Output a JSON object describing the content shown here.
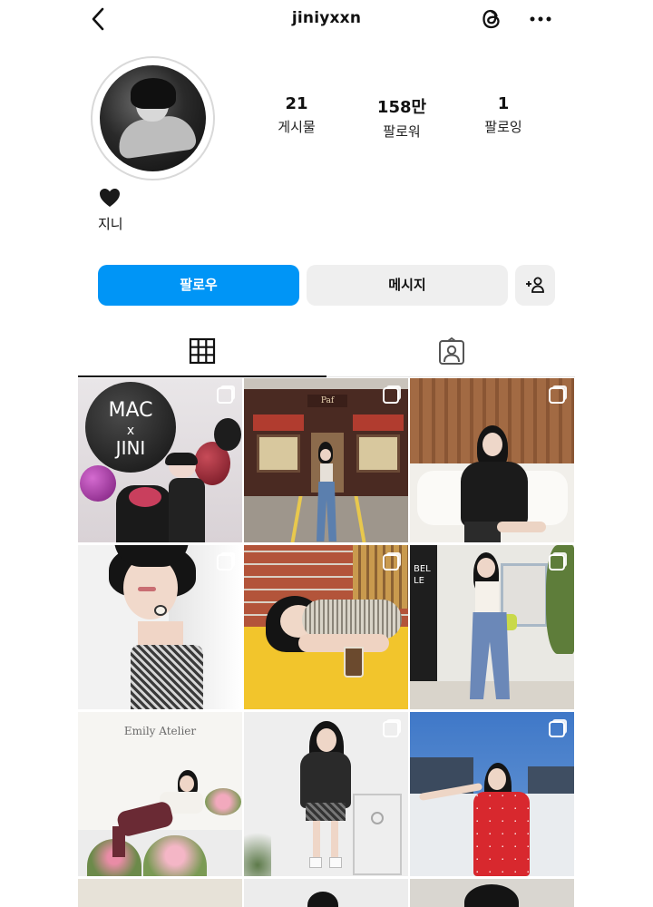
{
  "header": {
    "username": "jiniyxxn",
    "back_icon": "chevron-left-icon",
    "threads_icon": "threads-icon",
    "more_icon": "more-horizontal-icon"
  },
  "profile": {
    "avatar_icon": "profile-photo",
    "stats": [
      {
        "value": "21",
        "label": "게시물"
      },
      {
        "value": "158만",
        "label": "팔로워"
      },
      {
        "value": "1",
        "label": "팔로잉"
      }
    ],
    "bio_emoji": "black-heart-icon",
    "name": "지니"
  },
  "actions": {
    "follow_label": "팔로우",
    "message_label": "메시지",
    "add_user_icon": "add-user-icon",
    "follow_color": "#0095f6"
  },
  "tabs": [
    {
      "icon": "grid-icon",
      "active": true
    },
    {
      "icon": "tagged-icon",
      "active": false
    }
  ],
  "posts": [
    {
      "text_lines": [
        "MAC",
        "x",
        "JINI"
      ],
      "multi": true
    },
    {
      "store_sign": "Paf",
      "multi": true
    },
    {
      "multi": true
    },
    {
      "multi": true
    },
    {
      "multi": true
    },
    {
      "sign_text": "BELLE",
      "multi": true
    },
    {
      "store_sign": "Emily Atelier",
      "multi": false
    },
    {
      "multi": true
    },
    {
      "multi": true
    }
  ]
}
